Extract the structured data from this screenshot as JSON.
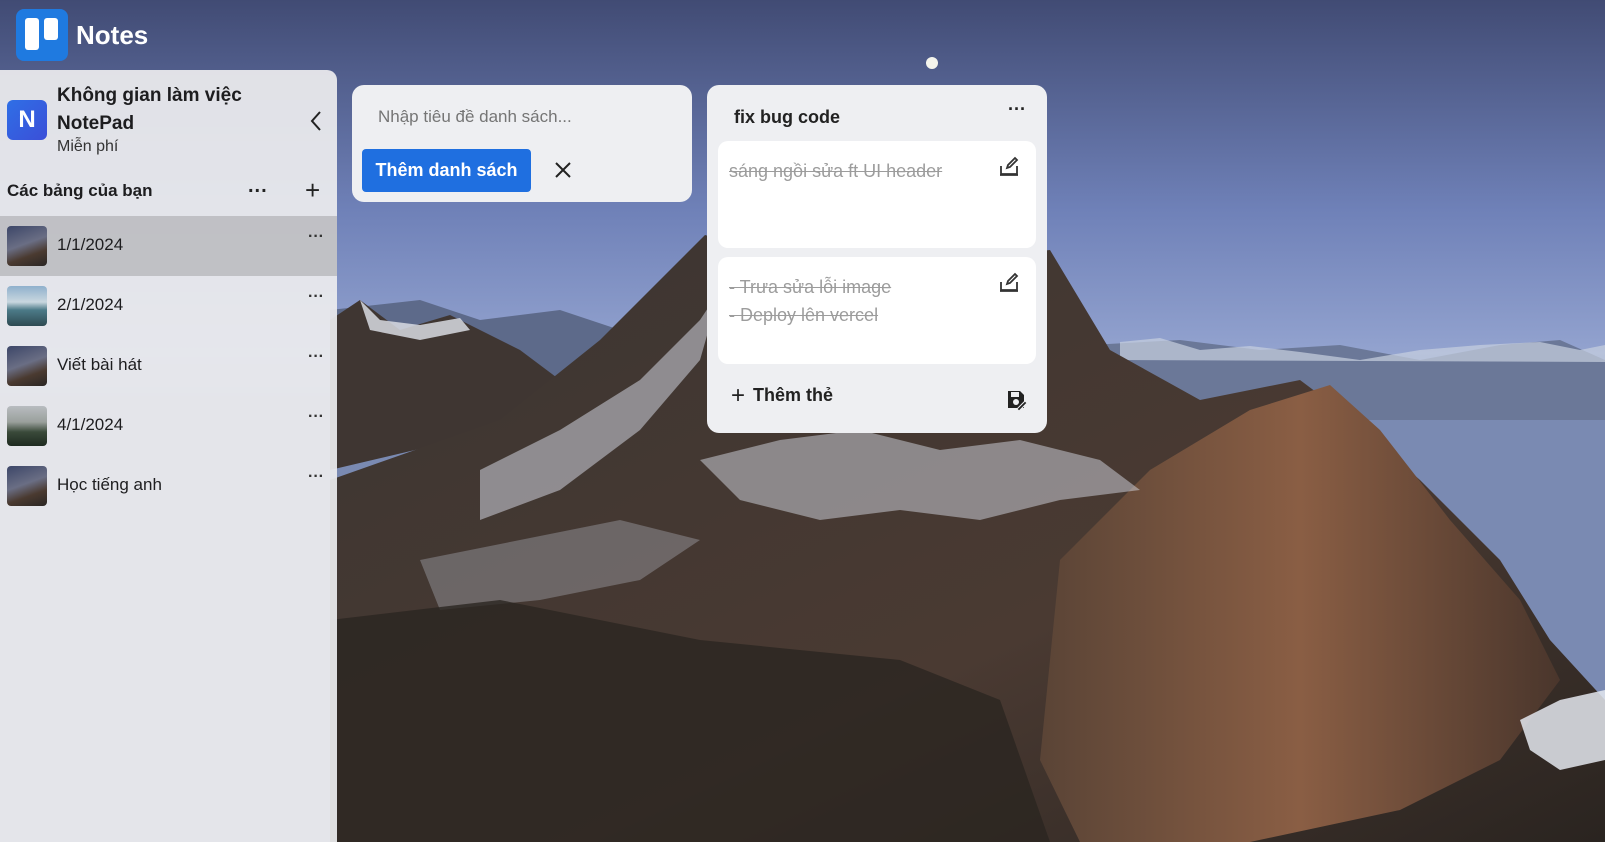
{
  "app": {
    "title": "Notes"
  },
  "workspace": {
    "avatar_letter": "N",
    "name": "Không gian làm việc NotePad",
    "plan": "Miễn phí"
  },
  "boards": {
    "title": "Các bảng của bạn",
    "more_label": "...",
    "add_label": "+",
    "items": [
      {
        "label": "1/1/2024",
        "active": true
      },
      {
        "label": "2/1/2024",
        "active": false
      },
      {
        "label": "Viết bài hát",
        "active": false
      },
      {
        "label": "4/1/2024",
        "active": false
      },
      {
        "label": "Học tiếng anh",
        "active": false
      }
    ],
    "item_more_label": "···"
  },
  "add_list": {
    "placeholder": "Nhập tiêu đề danh sách...",
    "submit_label": "Thêm danh sách"
  },
  "list": {
    "title": "fix bug code",
    "more_label": "···",
    "cards": [
      {
        "text": "sáng ngồi sửa ft UI header"
      },
      {
        "text": "- Trưa sửa lỗi image\n- Deploy lên vercel"
      }
    ],
    "add_card_label": "Thêm thẻ",
    "add_card_plus": "+"
  },
  "icons": {
    "collapse": "chevron-left-icon",
    "close": "close-icon",
    "edit": "edit-icon",
    "save": "save-icon"
  },
  "colors": {
    "accent": "#1f6fe0",
    "logo": "#1f7ae0"
  }
}
